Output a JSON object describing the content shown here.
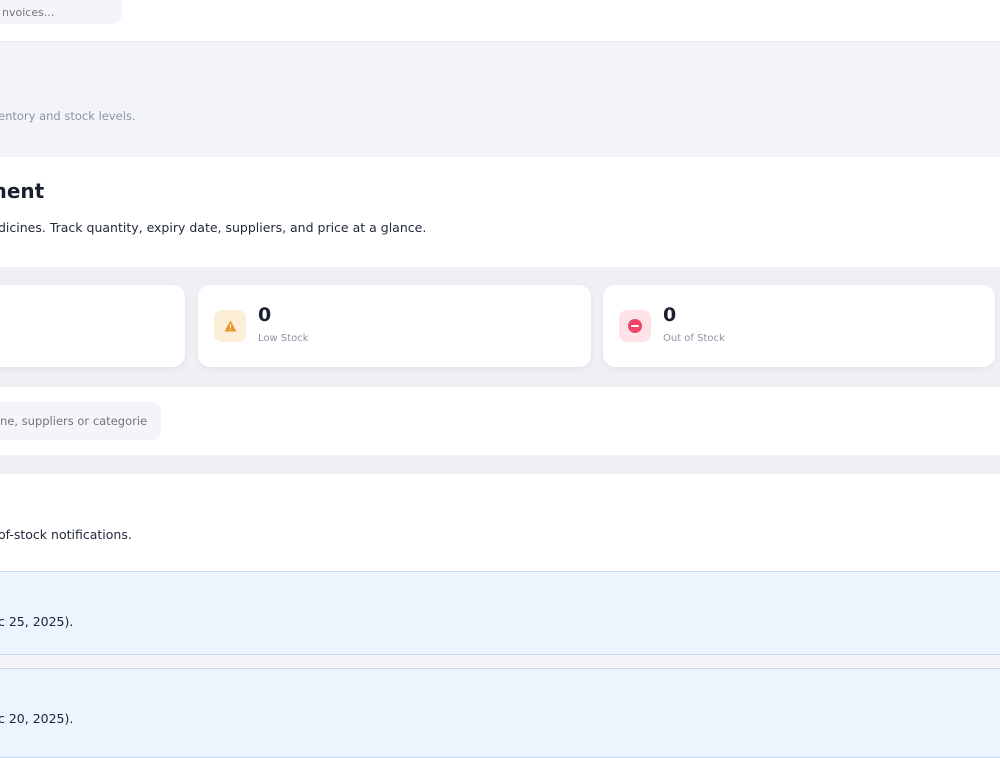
{
  "topbar": {
    "search_placeholder": "nvoices..."
  },
  "page_head": {
    "subtitle": "entory and stock levels."
  },
  "intro": {
    "title": "ment",
    "description": "dicines. Track quantity, expiry date, suppliers, and price at a glance."
  },
  "stats": [
    {
      "value": "0",
      "label": "Low Stock",
      "icon": "warning-icon",
      "color": "#e39a2a"
    },
    {
      "value": "0",
      "label": "Out of Stock",
      "icon": "no-entry-icon",
      "color": "#f0456b"
    }
  ],
  "filter": {
    "search_placeholder": "ne, suppliers or categories"
  },
  "alerts": {
    "description": "of-stock notifications.",
    "items": [
      {
        "text": "c 25, 2025)."
      },
      {
        "text": "c 20, 2025)."
      }
    ]
  }
}
